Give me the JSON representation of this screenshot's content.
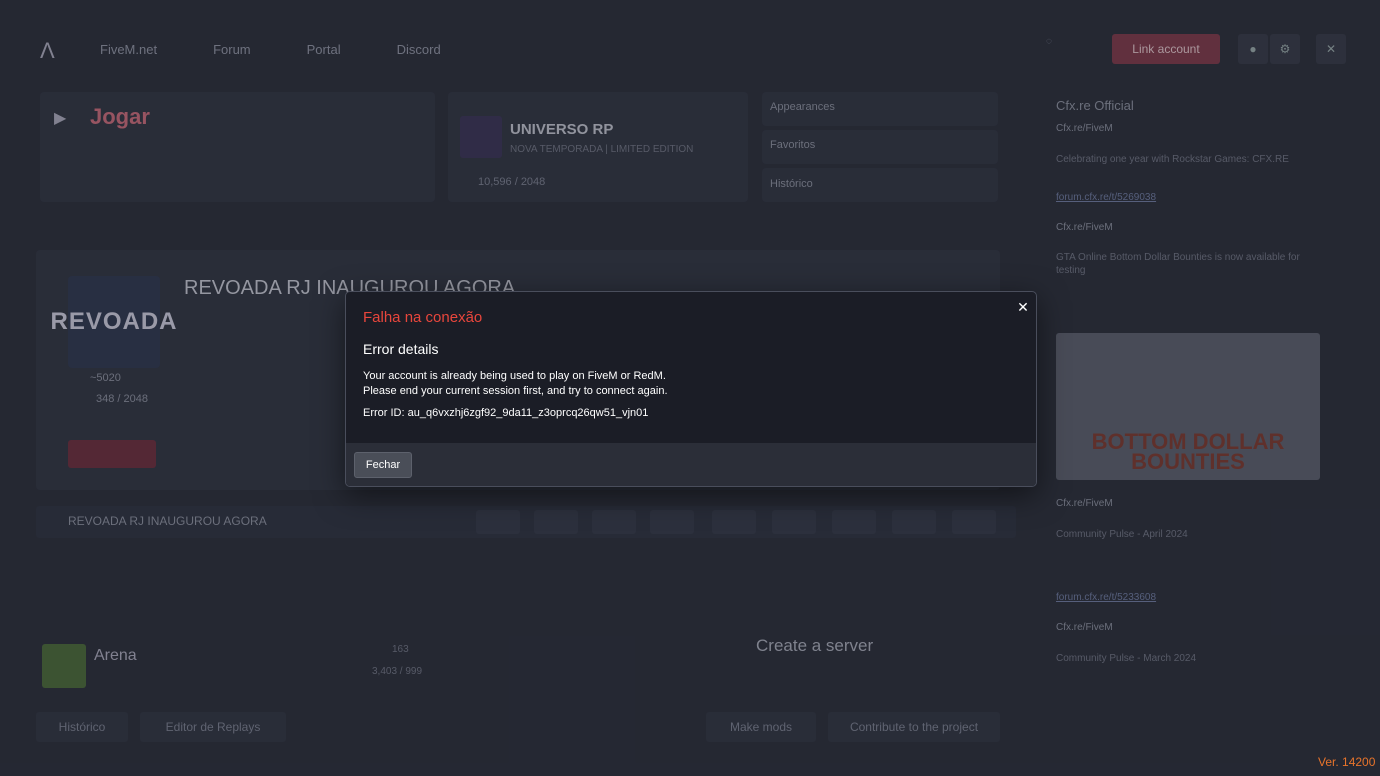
{
  "topbar": {
    "nav": [
      "FiveM.net",
      "Forum",
      "Portal",
      "Discord"
    ],
    "link_account": "Link account"
  },
  "play": {
    "title": "Jogar"
  },
  "last_server": {
    "name": "UNIVERSO RP",
    "desc": "NOVA TEMPORADA | LIMITED EDITION",
    "players": "10,596 / 2048"
  },
  "side_menu": [
    "Appearances",
    "Favoritos",
    "Histórico"
  ],
  "featured": {
    "name": "REVOADA RJ INAUGUROU AGORA",
    "thumb_text": "REVOADA",
    "players": "348 / 2048",
    "stat": "~5020"
  },
  "strip": {
    "title": "REVOADA RJ INAUGUROU AGORA"
  },
  "bottom": {
    "arena_title": "Arena",
    "arena_players": "163",
    "arena_count": "3,403 / 999",
    "create_title": "Create a server",
    "buttons": [
      "Histórico",
      "Editor de Replays",
      "Make mods",
      "Contribute to the project"
    ]
  },
  "news": {
    "heading": "Cfx.re Official",
    "items": [
      {
        "author": "Cfx.re/FiveM",
        "text": "Celebrating one year with Rockstar Games: CFX.RE",
        "link": "forum.cfx.re/t/5269038"
      },
      {
        "author": "Cfx.re/FiveM",
        "text": "GTA Online Bottom Dollar Bounties is now available for testing",
        "link": "forum.cfx.re/t/5233608"
      },
      {
        "author": "Cfx.re/FiveM",
        "text": "Community Pulse - April 2024",
        "link": ""
      },
      {
        "author": "Cfx.re/FiveM",
        "text": "Community Pulse - March 2024",
        "link": ""
      }
    ],
    "img_text": "BOTTOM DOLLAR BOUNTIES"
  },
  "modal": {
    "title": "Falha na conexão",
    "subtitle": "Error details",
    "line1": "Your account is already being used to play on FiveM or RedM.",
    "line2": "Please end your current session first, and try to connect again.",
    "error_id": "Error ID: au_q6vxzhj6zgf92_9da11_z3oprcq26qw51_vjn01",
    "close_symbol": "✕",
    "button": "Fechar"
  },
  "version": "Ver. 14200",
  "colors": {
    "error_title": "#e8463c",
    "version": "#e8742b",
    "modal_bg": "#1b1d26"
  }
}
